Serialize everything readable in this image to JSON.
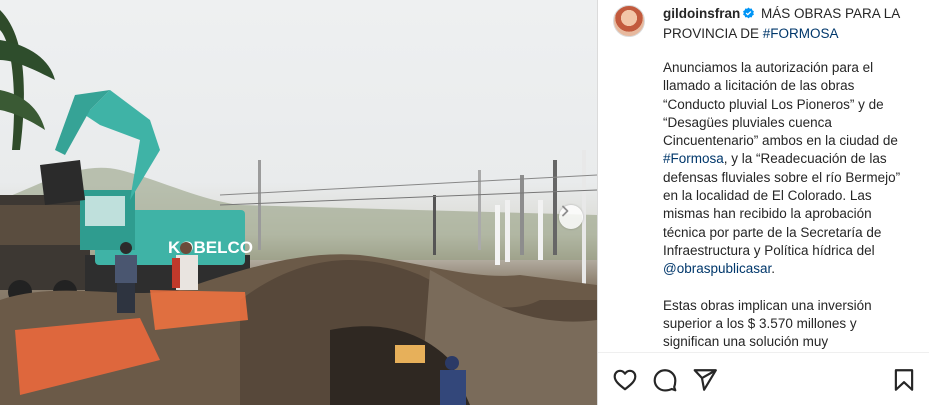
{
  "post": {
    "username": "gildoinsfran",
    "title_text": " MÁS OBRAS PARA LA PROVINCIA DE ",
    "title_hashtag": "#FORMOSA",
    "para1_a": "Anunciamos la autorización para el llamado a licitación de las obras “Conducto pluvial Los Pioneros” y de “Desagües pluviales cuenca Cincuentenario” ambos en la ciudad de ",
    "para1_tag": "#Formosa",
    "para1_b": ", y la “Readecuación de las defensas fluviales sobre el río Bermejo” en la localidad de El Colorado. Las mismas han recibido la aprobación técnica por parte de la Secretaría de Infraestructura y Política hídrica del ",
    "para1_mention": "@obraspublicasar",
    "para1_c": ".",
    "para2": "Estas obras implican una inversión superior a los $ 3.570 millones y significan una solución muy",
    "excavator_brand": "KOBELCO"
  },
  "icons": {
    "like": "heart-icon",
    "comment": "comment-icon",
    "share": "share-icon",
    "save": "bookmark-icon",
    "next": "chevron-right-icon",
    "verified": "verified-badge-icon"
  },
  "colors": {
    "link": "#00376b",
    "verified": "#0095f6",
    "excavator": "#3fb3a6"
  }
}
